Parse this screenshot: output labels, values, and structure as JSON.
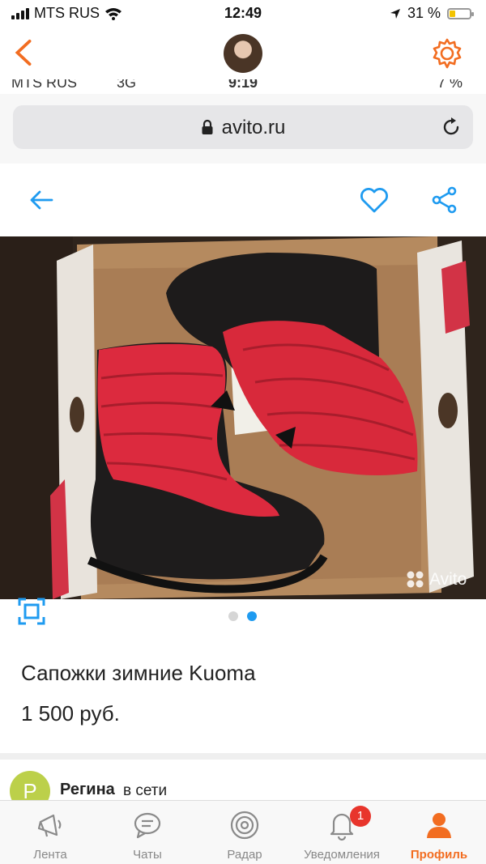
{
  "status_bar": {
    "carrier": "MTS RUS",
    "time": "12:49",
    "battery": "31 %",
    "battery_level": 0.31
  },
  "inner_status_bar": {
    "carrier": "MTS RUS",
    "network": "3G",
    "time": "9:19",
    "battery": "7 %"
  },
  "browser": {
    "url": "avito.ru"
  },
  "photo": {
    "watermark": "Avito",
    "current_index": 2,
    "total": 2
  },
  "listing": {
    "title": "Сапожки зимние Kuoma",
    "price": "1 500 руб."
  },
  "seller": {
    "initial": "Р",
    "name": "Регина",
    "status": "в сети"
  },
  "tabs": [
    {
      "label": "Лента",
      "icon": "feed-icon"
    },
    {
      "label": "Чаты",
      "icon": "chat-icon"
    },
    {
      "label": "Радар",
      "icon": "radar-icon"
    },
    {
      "label": "Уведомления",
      "icon": "bell-icon",
      "badge": "1"
    },
    {
      "label": "Профиль",
      "icon": "profile-icon",
      "active": true
    }
  ],
  "colors": {
    "accent": "#f26d21",
    "link_blue": "#1f9bf0",
    "badge_red": "#e8352c"
  }
}
